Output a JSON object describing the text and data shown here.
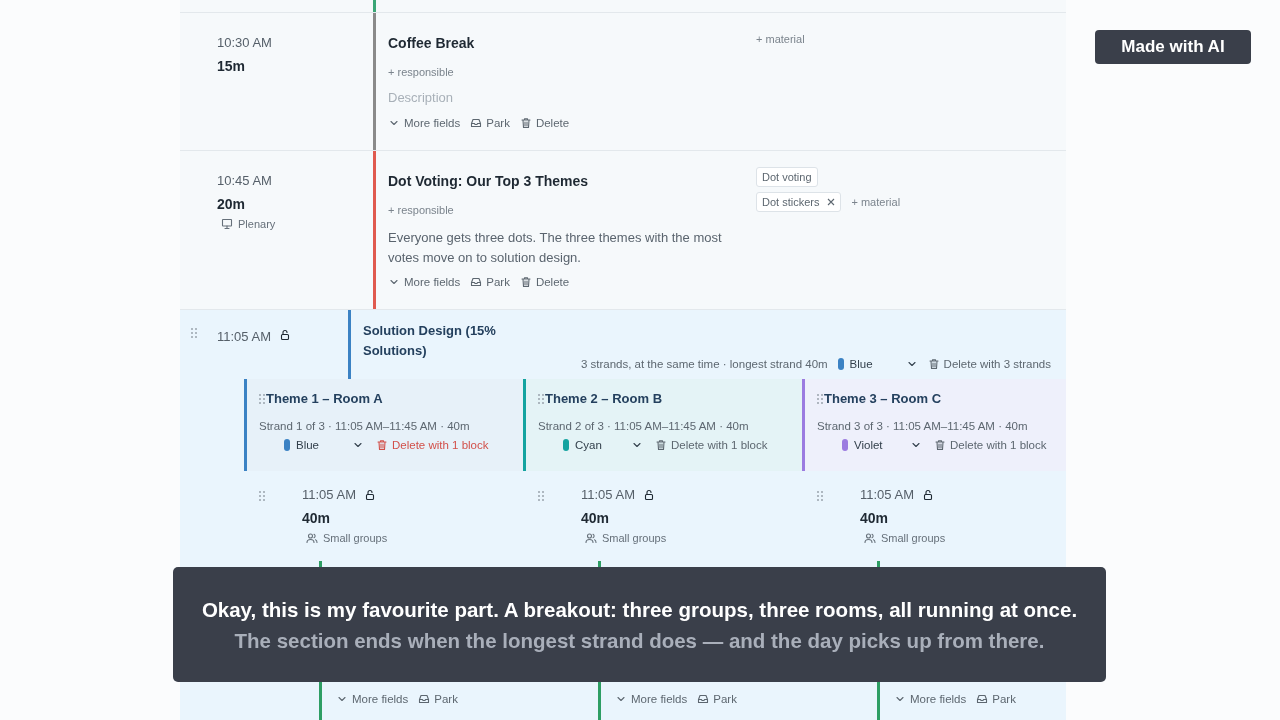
{
  "previous_session": {
    "color": "#3aa676"
  },
  "sessions": [
    {
      "time": "10:30 AM",
      "duration": "15m",
      "title": "Coffee Break",
      "color": "#8a8a8a",
      "responsible": "+ responsible",
      "description_placeholder": "Description",
      "add_material": "+ material",
      "actions": [
        {
          "kind": "more",
          "label": "More fields"
        },
        {
          "kind": "park",
          "label": "Park"
        },
        {
          "kind": "delete",
          "label": "Delete"
        }
      ]
    },
    {
      "time": "10:45 AM",
      "duration": "20m",
      "format": {
        "kind": "plenary",
        "label": "Plenary"
      },
      "title": "Dot Voting: Our Top 3 Themes",
      "color": "#e05a4f",
      "responsible": "+ responsible",
      "description": "Everyone gets three dots. The three themes with the most votes move on to solution design.",
      "materials": [
        {
          "label": "Dot voting",
          "removable": false
        },
        {
          "label": "Dot stickers",
          "removable": true
        }
      ],
      "add_material": "+ material",
      "actions": [
        {
          "kind": "more",
          "label": "More fields"
        },
        {
          "kind": "park",
          "label": "Park"
        },
        {
          "kind": "delete",
          "label": "Delete"
        }
      ]
    }
  ],
  "section": {
    "time": "11:05 AM",
    "title": "Solution Design (15% Solutions)",
    "color": "#3b82c4",
    "info": "3 strands, at the same time · longest strand 40m",
    "color_select": {
      "label": "Blue",
      "color": "#3b82c4"
    },
    "delete": "Delete with 3 strands",
    "strands": [
      {
        "title": "Theme 1 – Room A",
        "info": "Strand 1 of 3 · 11:05 AM–11:45 AM · 40m",
        "color": "#3b82c4",
        "color_select": {
          "label": "Blue",
          "color": "#3b82c4"
        },
        "delete": {
          "label": "Delete with 1 block",
          "highlighted": true
        },
        "block": {
          "time": "11:05 AM",
          "duration": "40m",
          "format": {
            "kind": "groups",
            "label": "Small groups"
          },
          "color": "#2e9e64",
          "actions": [
            {
              "kind": "more",
              "label": "More fields"
            },
            {
              "kind": "park",
              "label": "Park"
            }
          ]
        }
      },
      {
        "title": "Theme 2 – Room B",
        "info": "Strand 2 of 3 · 11:05 AM–11:45 AM · 40m",
        "color": "#14a3a0",
        "color_select": {
          "label": "Cyan",
          "color": "#14a3a0"
        },
        "delete": {
          "label": "Delete with 1 block",
          "highlighted": false
        },
        "block": {
          "time": "11:05 AM",
          "duration": "40m",
          "format": {
            "kind": "groups",
            "label": "Small groups"
          },
          "color": "#2e9e64",
          "actions": [
            {
              "kind": "more",
              "label": "More fields"
            },
            {
              "kind": "park",
              "label": "Park"
            }
          ]
        }
      },
      {
        "title": "Theme 3 – Room C",
        "info": "Strand 3 of 3 · 11:05 AM–11:45 AM · 40m",
        "color": "#9b7be0",
        "color_select": {
          "label": "Violet",
          "color": "#9b7be0"
        },
        "delete": {
          "label": "Delete with 1 block",
          "highlighted": false
        },
        "block": {
          "time": "11:05 AM",
          "duration": "40m",
          "format": {
            "kind": "groups",
            "label": "Small groups"
          },
          "color": "#2e9e64",
          "actions": [
            {
              "kind": "more",
              "label": "More fields"
            },
            {
              "kind": "park",
              "label": "Park"
            }
          ]
        }
      }
    ]
  },
  "caption": {
    "spoken": "Okay, this is my favourite part. A breakout: three groups, three rooms, all running at once.",
    "upcoming": "The section ends when the longest strand does — and the day picks up from there."
  },
  "badge": "Made with AI"
}
